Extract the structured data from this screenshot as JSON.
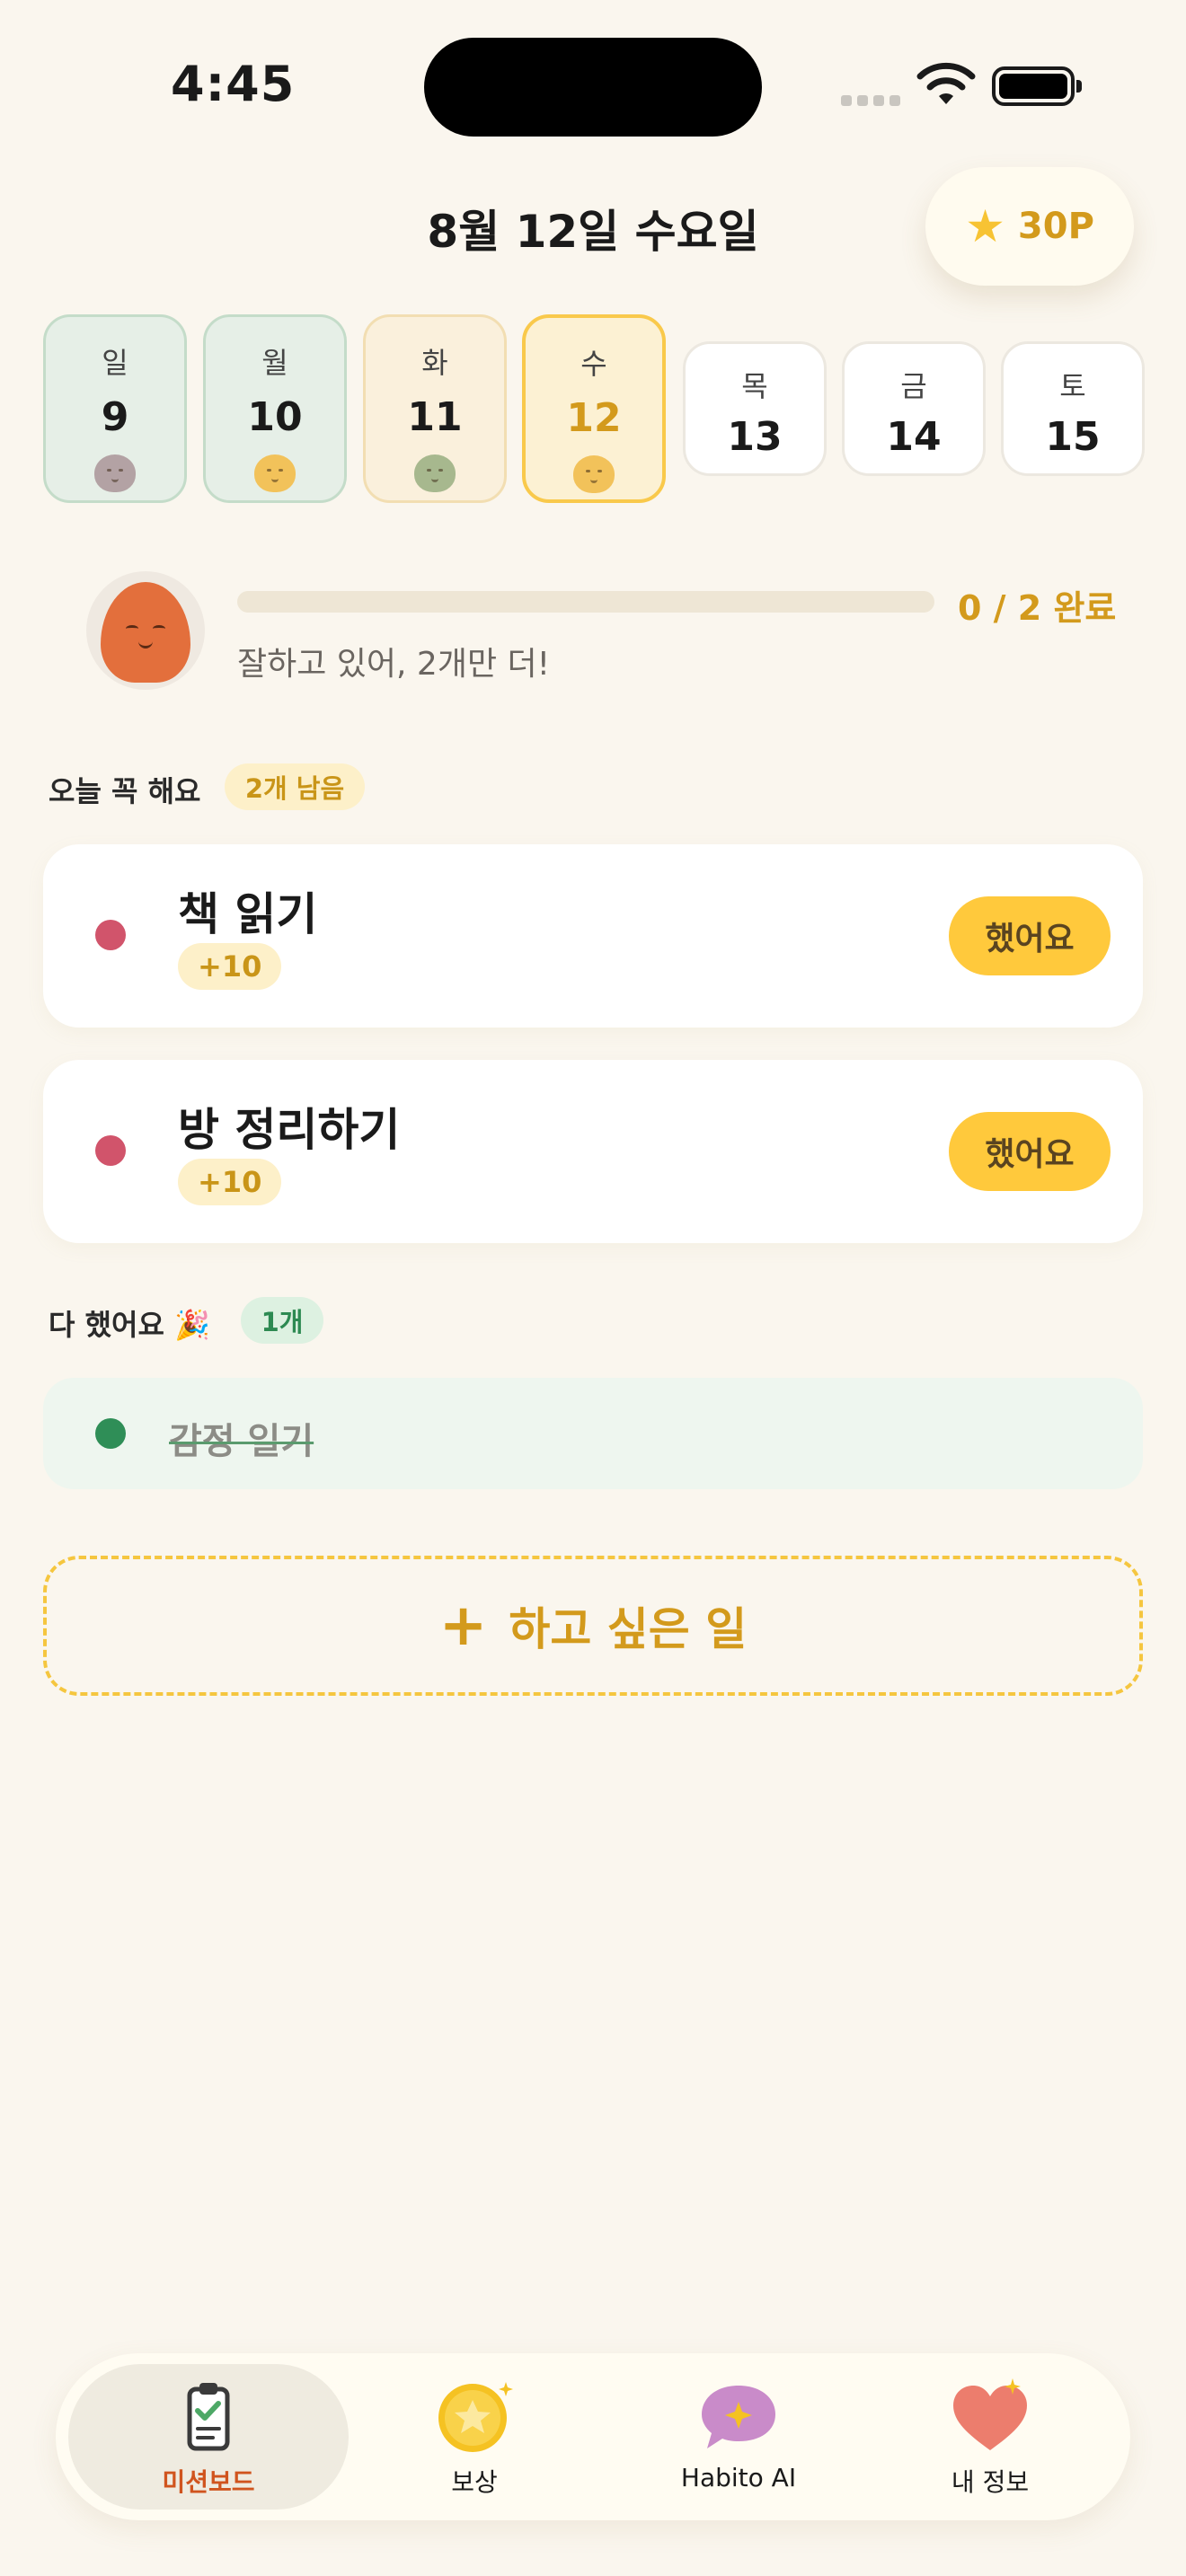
{
  "status_bar": {
    "time": "4:45"
  },
  "header": {
    "date": "8월 12일 수요일",
    "points": "30P",
    "points_icon": "star-icon"
  },
  "week": [
    {
      "weekday": "일",
      "date": "9",
      "state": "past",
      "mood_color": "#B3A2A4"
    },
    {
      "weekday": "월",
      "date": "10",
      "state": "past",
      "mood_color": "#F2C25A"
    },
    {
      "weekday": "화",
      "date": "11",
      "state": "past",
      "mood_color": "#A7B88E"
    },
    {
      "weekday": "수",
      "date": "12",
      "state": "today",
      "mood_color": "#F2C25A"
    },
    {
      "weekday": "목",
      "date": "13",
      "state": "future"
    },
    {
      "weekday": "금",
      "date": "14",
      "state": "future"
    },
    {
      "weekday": "토",
      "date": "15",
      "state": "future"
    }
  ],
  "progress": {
    "count_label": "0 / 2 완료",
    "completed": 0,
    "total": 2,
    "message": "잘하고 있어, 2개만 더!"
  },
  "todo_section": {
    "title": "오늘 꼭 해요",
    "badge": "2개 남음"
  },
  "tasks": [
    {
      "title": "책 읽기",
      "points": "+10",
      "button": "했어요"
    },
    {
      "title": "방 정리하기",
      "points": "+10",
      "button": "했어요"
    }
  ],
  "done_section": {
    "title": "다 했어요 🎉",
    "badge": "1개"
  },
  "done_tasks": [
    {
      "title": "감정 일기"
    }
  ],
  "add_button": {
    "label": "하고 싶은 일"
  },
  "bottom_nav": [
    {
      "label": "미션보드",
      "icon": "clipboard-check-icon",
      "active": true
    },
    {
      "label": "보상",
      "icon": "star-coin-icon",
      "active": false
    },
    {
      "label": "Habito AI",
      "icon": "ai-chat-bubble-icon",
      "active": false
    },
    {
      "label": "내 정보",
      "icon": "heart-icon",
      "active": false
    }
  ],
  "colors": {
    "accent": "#FFC93C",
    "accent_text": "#D39A1C",
    "task_dot": "#D1546B",
    "done_dot": "#2F8E57",
    "nav_active": "#D0541E"
  }
}
